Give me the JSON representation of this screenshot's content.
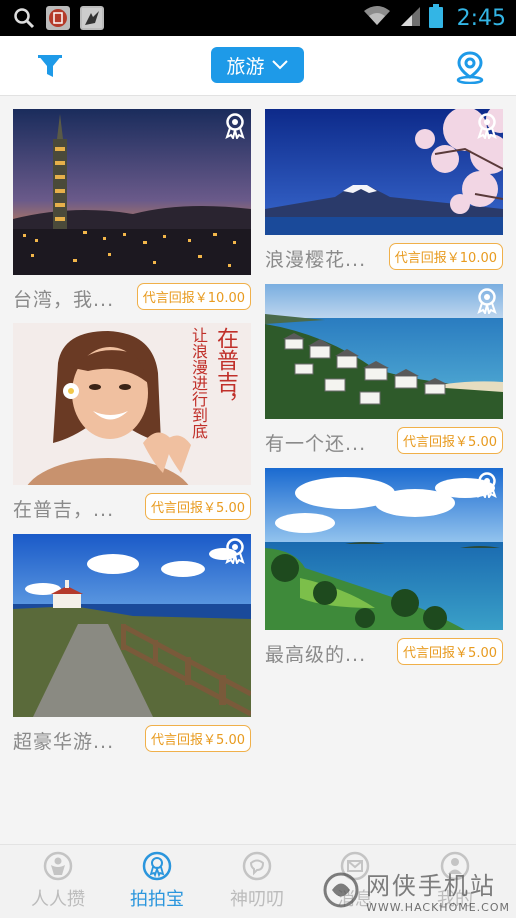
{
  "status_bar": {
    "time": "2:45",
    "icons": [
      "search-icon",
      "app-notification-icon",
      "app-notification-icon",
      "wifi-icon",
      "signal-icon",
      "battery-icon"
    ]
  },
  "top_bar": {
    "category_label": "旅游",
    "icons": [
      "filter-icon",
      "chevron-down-icon",
      "location-pin-icon"
    ],
    "accent_color": "#1e9ae8"
  },
  "cards": [
    {
      "title": "台湾，我...",
      "reward": "代言回报￥10.00",
      "scene": "taipei-night-skyline"
    },
    {
      "title": "浪漫樱花...",
      "reward": "代言回报￥10.00",
      "scene": "mount-fuji-cherry-blossom"
    },
    {
      "title": "在普吉，...",
      "reward": "代言回报￥5.00",
      "scene": "woman-portrait",
      "overlay_lines": [
        "在普吉，",
        "让浪漫进行到底"
      ]
    },
    {
      "title": "有一个还...",
      "reward": "代言回报￥5.00",
      "scene": "coastal-resort"
    },
    {
      "title": "超豪华游...",
      "reward": "代言回报￥5.00",
      "scene": "seaside-path-lighthouse"
    },
    {
      "title": "最高级的...",
      "reward": "代言回报￥5.00",
      "scene": "tropical-island-bay"
    }
  ],
  "bottom_nav": {
    "tabs": [
      {
        "label": "人人攒",
        "icon": "people-icon",
        "active": false
      },
      {
        "label": "拍拍宝",
        "icon": "badge-icon",
        "active": true
      },
      {
        "label": "神叨叨",
        "icon": "chat-icon",
        "active": false
      },
      {
        "label": "消息",
        "icon": "message-icon",
        "active": false
      },
      {
        "label": "我的",
        "icon": "user-icon",
        "active": false
      }
    ],
    "active_color": "#2b96dd"
  },
  "watermark": {
    "main": "网侠手机站",
    "sub": "WWW.HACKHOME.COM"
  }
}
